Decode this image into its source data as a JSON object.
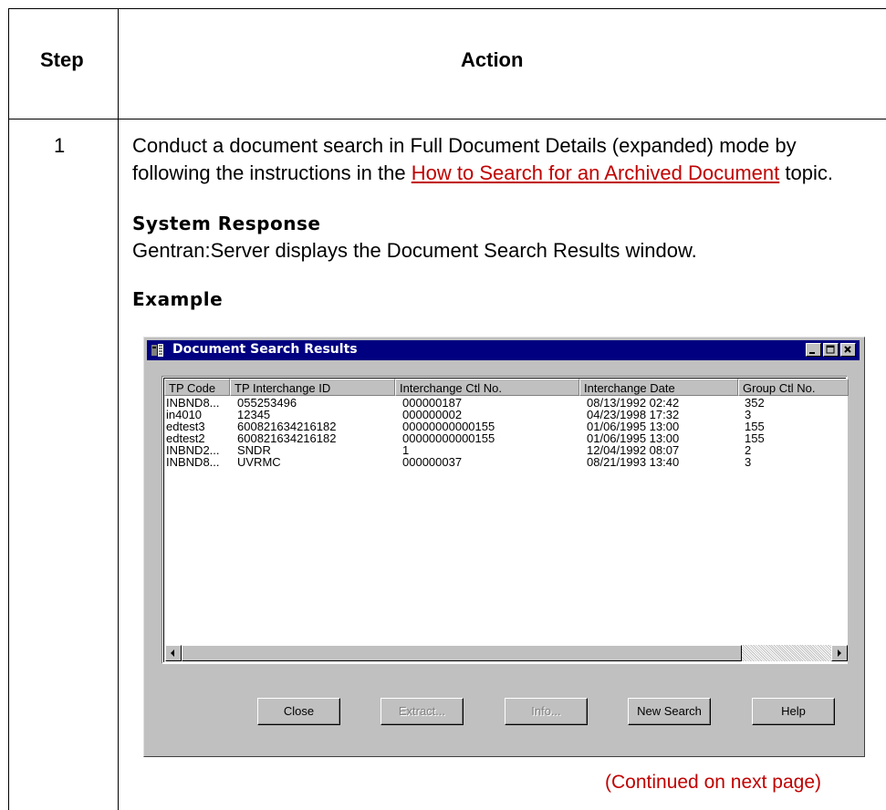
{
  "table": {
    "header_step": "Step",
    "header_action": "Action",
    "step_number": "1",
    "instruction_before": "Conduct a document search in Full Document Details (expanded) mode by following the instructions in the ",
    "instruction_link": "How to Search for an Archived Document",
    "instruction_after": " topic.",
    "response_heading": "System Response",
    "response_text": "Gentran:Server displays the Document Search Results window.",
    "example_heading": "Example",
    "continued": "(Continued on next page)"
  },
  "window": {
    "title": "Document Search Results",
    "columns": [
      "TP Code",
      "TP Interchange ID",
      "Interchange Ctl No.",
      "Interchange Date",
      "Group Ctl No."
    ],
    "rows": [
      [
        "INBND8...",
        "055253496",
        "000000187",
        "08/13/1992 02:42",
        "352"
      ],
      [
        "in4010",
        "12345",
        "000000002",
        "04/23/1998 17:32",
        "3"
      ],
      [
        "edtest3",
        "600821634216182",
        "00000000000155",
        "01/06/1995 13:00",
        "155"
      ],
      [
        "edtest2",
        "600821634216182",
        "00000000000155",
        "01/06/1995 13:00",
        "155"
      ],
      [
        "INBND2...",
        "SNDR",
        "1",
        "12/04/1992 08:07",
        "2"
      ],
      [
        "INBND8...",
        "UVRMC",
        "000000037",
        "08/21/1993 13:40",
        "3"
      ]
    ],
    "buttons": {
      "close": "Close",
      "extract": "Extract...",
      "info": "Info...",
      "new_search": "New Search",
      "help": "Help"
    },
    "icons": {
      "app": "app-icon",
      "minimize": "minimize-icon",
      "maximize": "maximize-icon",
      "close": "close-icon",
      "scroll_left": "scroll-left-arrow-icon",
      "scroll_right": "scroll-right-arrow-icon"
    },
    "colors": {
      "titlebar": "#000080",
      "face": "#c0c0c0",
      "link": "#c00000"
    }
  }
}
